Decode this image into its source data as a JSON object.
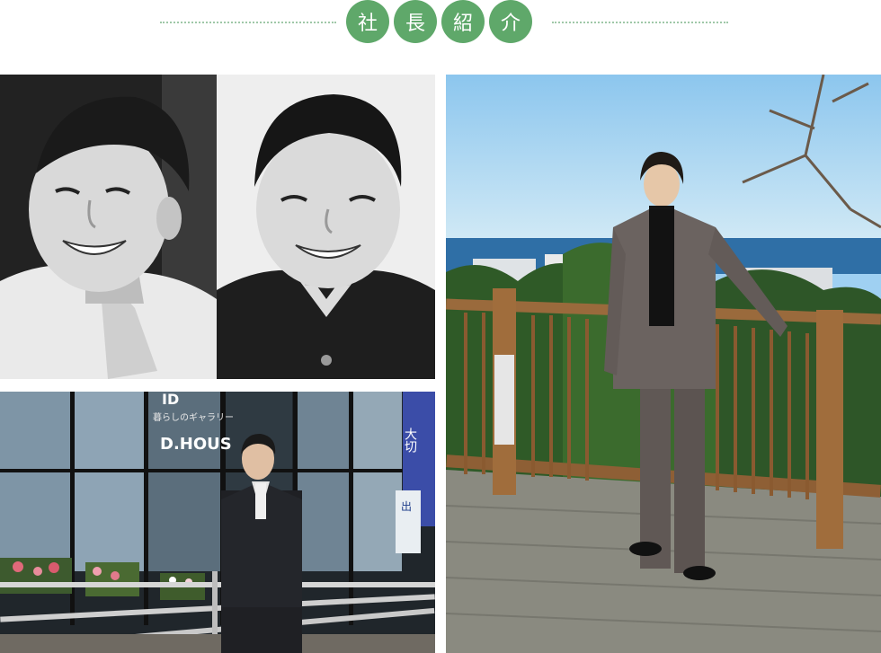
{
  "header": {
    "title_chars": [
      "社",
      "長",
      "紹",
      "介"
    ],
    "accent_color": "#5fa86a",
    "dot_color": "#9fc8a8"
  },
  "photos": {
    "store_sign_small": "暮らしのギャラリー",
    "store_sign_large": "D.HOUS",
    "store_sign_top": "ID",
    "banner_text": "大切",
    "booth_sign": "出"
  }
}
